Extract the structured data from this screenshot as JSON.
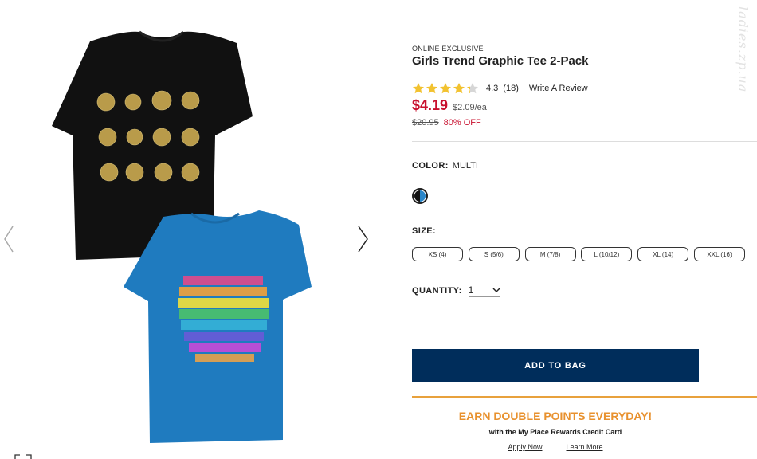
{
  "product": {
    "badge": "ONLINE EXCLUSIVE",
    "title": "Girls Trend Graphic Tee 2-Pack",
    "rating": {
      "value": "4.3",
      "count": "(18)",
      "stars": 4.3,
      "max_stars": 5,
      "write_review": "Write A Review"
    },
    "price": "$4.19",
    "per_unit": "$2.09/ea",
    "was_price": "$20.95",
    "discount": "80% OFF"
  },
  "color": {
    "label": "COLOR:",
    "value": "MULTI"
  },
  "size": {
    "label": "SIZE:",
    "options": [
      "XS (4)",
      "S (5/6)",
      "M (7/8)",
      "L (10/12)",
      "XL (14)",
      "XXL (16)"
    ]
  },
  "quantity": {
    "label": "QUANTITY:",
    "value": "1"
  },
  "add_to_bag": "ADD TO BAG",
  "promo": {
    "title": "EARN DOUBLE POINTS EVERYDAY!",
    "subtitle": "with the My Place Rewards Credit Card",
    "apply": "Apply Now",
    "learn": "Learn More"
  },
  "watermark": "ladies.zp.ua",
  "colors": {
    "price_red": "#c8102e",
    "button_navy": "#002d5b",
    "promo_orange": "#e8912e",
    "star_gold": "#f2c230"
  },
  "icons": {
    "prev": "chevron-left-icon",
    "next": "chevron-right-icon",
    "qty": "chevron-down-icon",
    "expand": "expand-icon"
  }
}
